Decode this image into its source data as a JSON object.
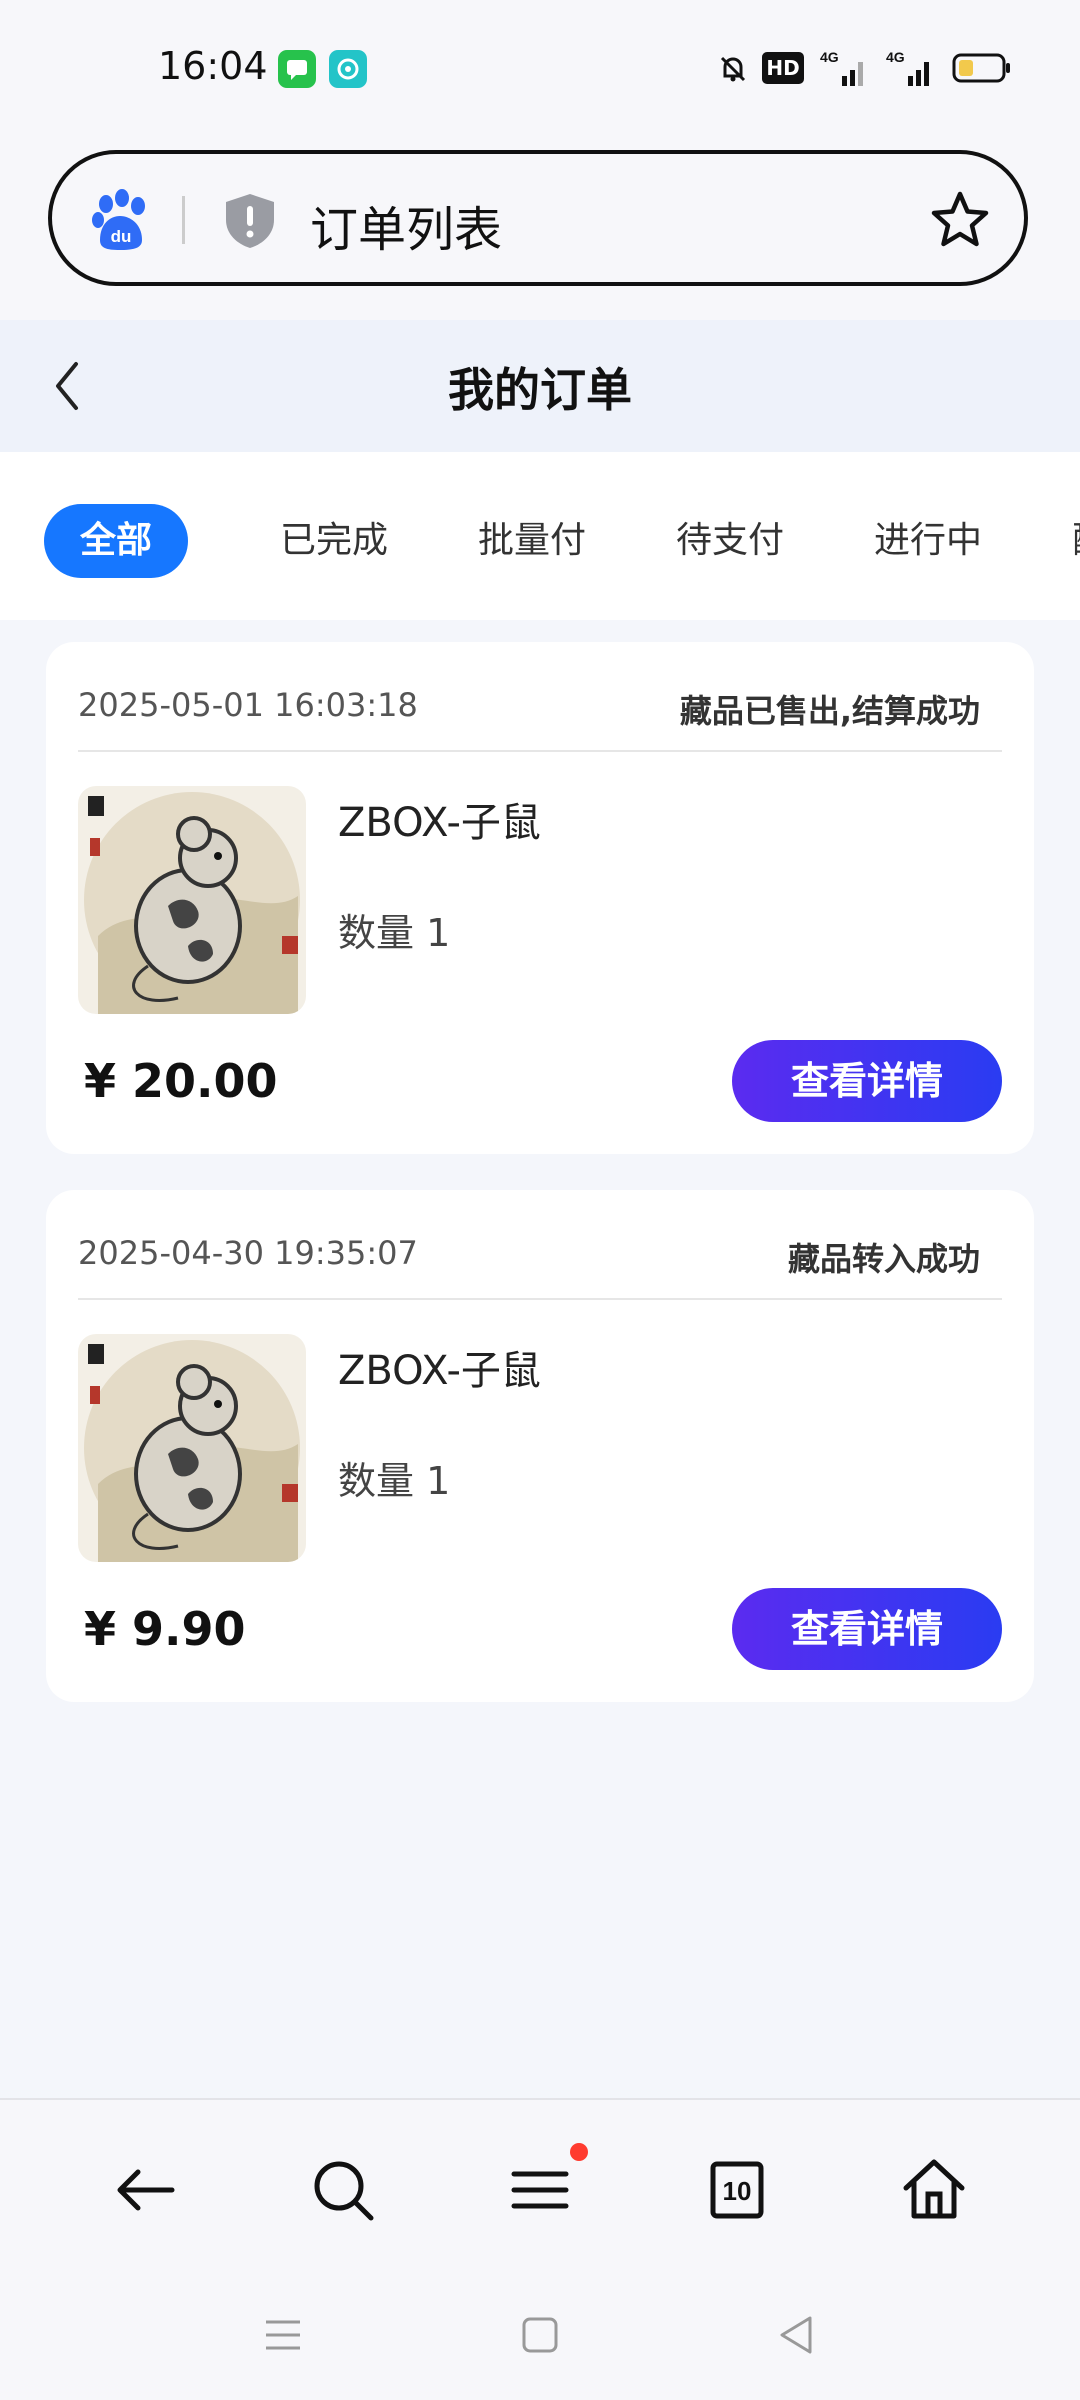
{
  "status_bar": {
    "time": "16:04",
    "icons": [
      "messages-app-icon",
      "green-app-icon",
      "mute-bell-icon",
      "hd-icon",
      "signal-4g-icon",
      "signal-4g-icon",
      "battery-icon"
    ],
    "hd_label": "HD",
    "network_label": "4G"
  },
  "address_bar": {
    "title": "订单列表",
    "left_icon": "baidu-paw-icon",
    "shield_icon": "shield-warning-icon",
    "right_icon": "star-icon",
    "logo_text": "du"
  },
  "header": {
    "title": "我的订单",
    "back_icon": "chevron-left-icon"
  },
  "tabs": [
    {
      "label": "全部",
      "active": true
    },
    {
      "label": "已完成",
      "active": false
    },
    {
      "label": "批量付",
      "active": false
    },
    {
      "label": "待支付",
      "active": false
    },
    {
      "label": "进行中",
      "active": false
    },
    {
      "label": "配",
      "active": false
    }
  ],
  "orders": [
    {
      "datetime": "2025-05-01 16:03:18",
      "status": "藏品已售出,结算成功",
      "product_name": "ZBOX-子鼠",
      "quantity": "数量 1",
      "price": "¥ 20.00",
      "button": "查看详情"
    },
    {
      "datetime": "2025-04-30 19:35:07",
      "status": "藏品转入成功",
      "product_name": "ZBOX-子鼠",
      "quantity": "数量 1",
      "price": "¥ 9.90",
      "button": "查看详情"
    }
  ],
  "bottom_nav": {
    "items": [
      "back-arrow-icon",
      "search-icon",
      "menu-icon",
      "tabs-count-icon",
      "home-icon"
    ],
    "tabs_count": "10",
    "badge_color": "#ff3b2f"
  },
  "system_nav": [
    "recent-apps-icon",
    "home-square-icon",
    "back-triangle-icon"
  ],
  "colors": {
    "accent": "#1677ff",
    "button_gradient_start": "#5b2bf0",
    "button_gradient_end": "#2a3cf2",
    "page_bg": "#f4f6fb"
  }
}
